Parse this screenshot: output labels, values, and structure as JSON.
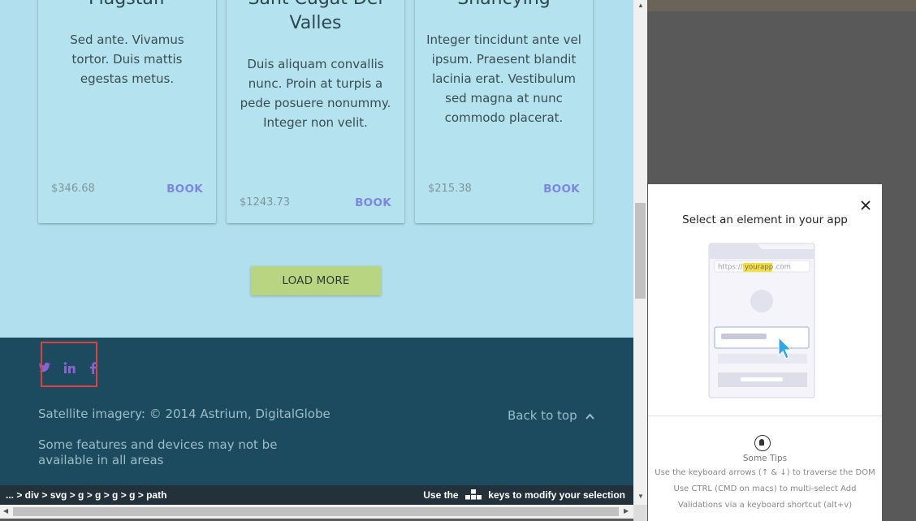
{
  "cards": [
    {
      "title": "Flagstaff",
      "description": "Sed ante. Vivamus tortor. Duis mattis egestas metus.",
      "price": "$346.68",
      "book_label": "BOOK"
    },
    {
      "title": "Sant Cugat Del Valles",
      "description": "Duis aliquam convallis nunc. Proin at turpis a pede posuere nonummy. Integer non velit.",
      "price": "$1243.73",
      "book_label": "BOOK"
    },
    {
      "title": "Shancying",
      "description": "Integer tincidunt ante vel ipsum. Praesent blandit lacinia erat. Vestibulum sed magna at nunc commodo placerat.",
      "price": "$215.38",
      "book_label": "BOOK"
    }
  ],
  "load_more_label": "LOAD MORE",
  "footer": {
    "social_icons": [
      "twitter-icon",
      "linkedin-icon",
      "facebook-icon"
    ],
    "copyright": "Satellite imagery: © 2014 Astrium, DigitalGlobe",
    "note": "Some features and devices may not be available in all areas",
    "back_to_top": "Back to top"
  },
  "path_bar": {
    "crumbs": "... > div > svg > g > g > g > g > path",
    "hint_prefix": "Use the",
    "hint_suffix": "keys to modify your selection"
  },
  "panel": {
    "title": "Select an element in your app",
    "illustration_url_prefix": "https://",
    "illustration_url_highlight": "yourapp",
    "illustration_url_suffix": ".com",
    "tips_title": "Some Tips",
    "tips": [
      "Use the keyboard arrows (↑ & ↓) to traverse the DOM",
      "Use CTRL (CMD on macs) to multi-select Add",
      "Validations via a keyboard shortcut (alt+v)"
    ]
  },
  "colors": {
    "app_background": "#b2dfed",
    "footer_background": "#1c4b5f",
    "book_accent": "#7e86e0",
    "load_more": "#b8d582",
    "selection_outline": "#e04040"
  }
}
